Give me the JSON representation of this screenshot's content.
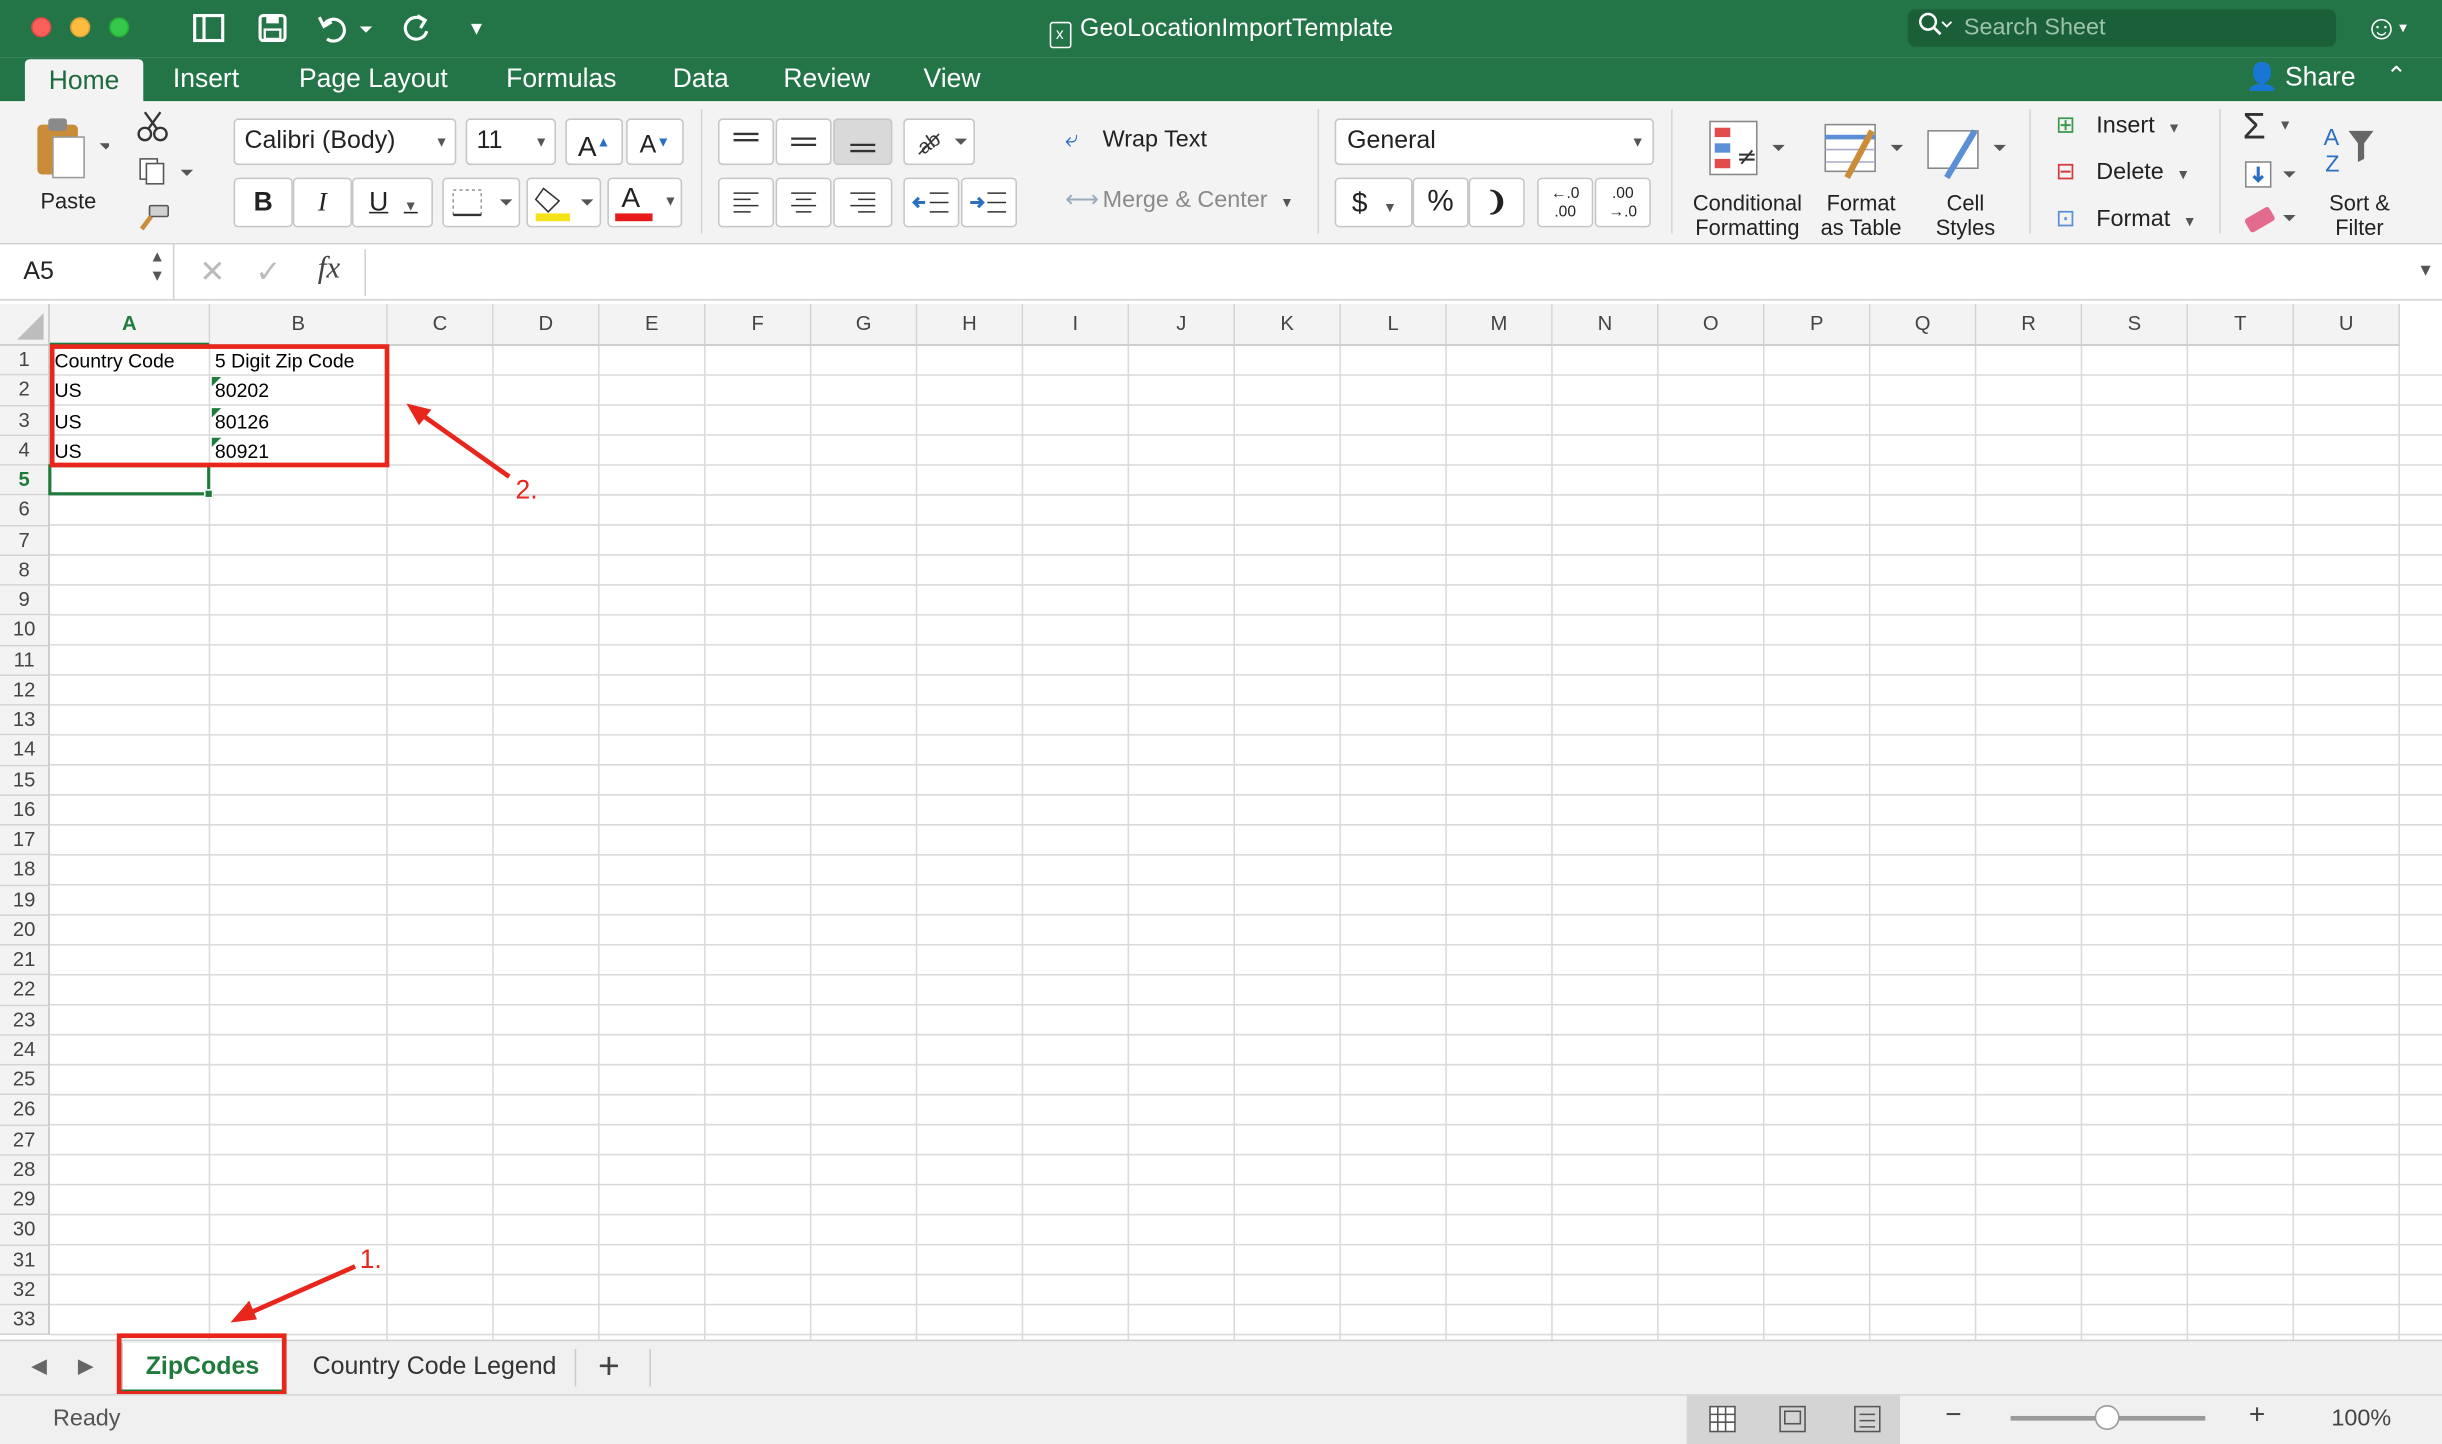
{
  "window": {
    "title": "GeoLocationImportTemplate",
    "search_placeholder": "Search Sheet"
  },
  "ribbon_tabs": [
    "Home",
    "Insert",
    "Page Layout",
    "Formulas",
    "Data",
    "Review",
    "View"
  ],
  "share_label": "Share",
  "clipboard": {
    "paste": "Paste"
  },
  "font": {
    "name": "Calibri (Body)",
    "size": "11",
    "bold": "B",
    "italic": "I",
    "underline": "U",
    "grow": "A",
    "shrink": "A",
    "color_letter": "A"
  },
  "alignment": {
    "wrap": "Wrap Text",
    "merge": "Merge & Center"
  },
  "number": {
    "format": "General",
    "currency": "$",
    "percent": "%",
    "comma": "❩",
    "inc_dec_top": "←.0",
    "inc_dec_bottom": ".00",
    "dec_dec_top": ".00",
    "dec_dec_bottom": "→.0"
  },
  "styles": {
    "cond1": "Conditional",
    "cond2": "Formatting",
    "fmt1": "Format",
    "fmt2": "as Table",
    "cell1": "Cell",
    "cell2": "Styles"
  },
  "cells_group": {
    "insert": "Insert",
    "delete": "Delete",
    "format": "Format"
  },
  "editing": {
    "sort1": "Sort &",
    "sort2": "Filter",
    "sigma": "Σ"
  },
  "formula_bar": {
    "name_box": "A5",
    "fx": "fx",
    "value": ""
  },
  "columns": [
    "A",
    "B",
    "C",
    "D",
    "E",
    "F",
    "G",
    "H",
    "I",
    "J",
    "K",
    "L",
    "M",
    "N",
    "O",
    "P",
    "Q",
    "R",
    "S",
    "T",
    "U"
  ],
  "row_count": 33,
  "cells": [
    [
      "Country Code",
      "5 Digit Zip Code"
    ],
    [
      "US",
      "80202"
    ],
    [
      "US",
      "80126"
    ],
    [
      "US",
      "80921"
    ]
  ],
  "selected_cell": "A5",
  "sheet_tabs": [
    "ZipCodes",
    "Country Code Legend"
  ],
  "active_sheet": "ZipCodes",
  "add_sheet": "+",
  "status": {
    "text": "Ready",
    "zoom": "100%",
    "zoom_minus": "−",
    "zoom_plus": "+"
  },
  "annotations": {
    "label1": "1.",
    "label2": "2."
  },
  "colors": {
    "excel_green": "#237447",
    "annotation_red": "#e8261b",
    "selection_green": "#1e7b3c"
  }
}
